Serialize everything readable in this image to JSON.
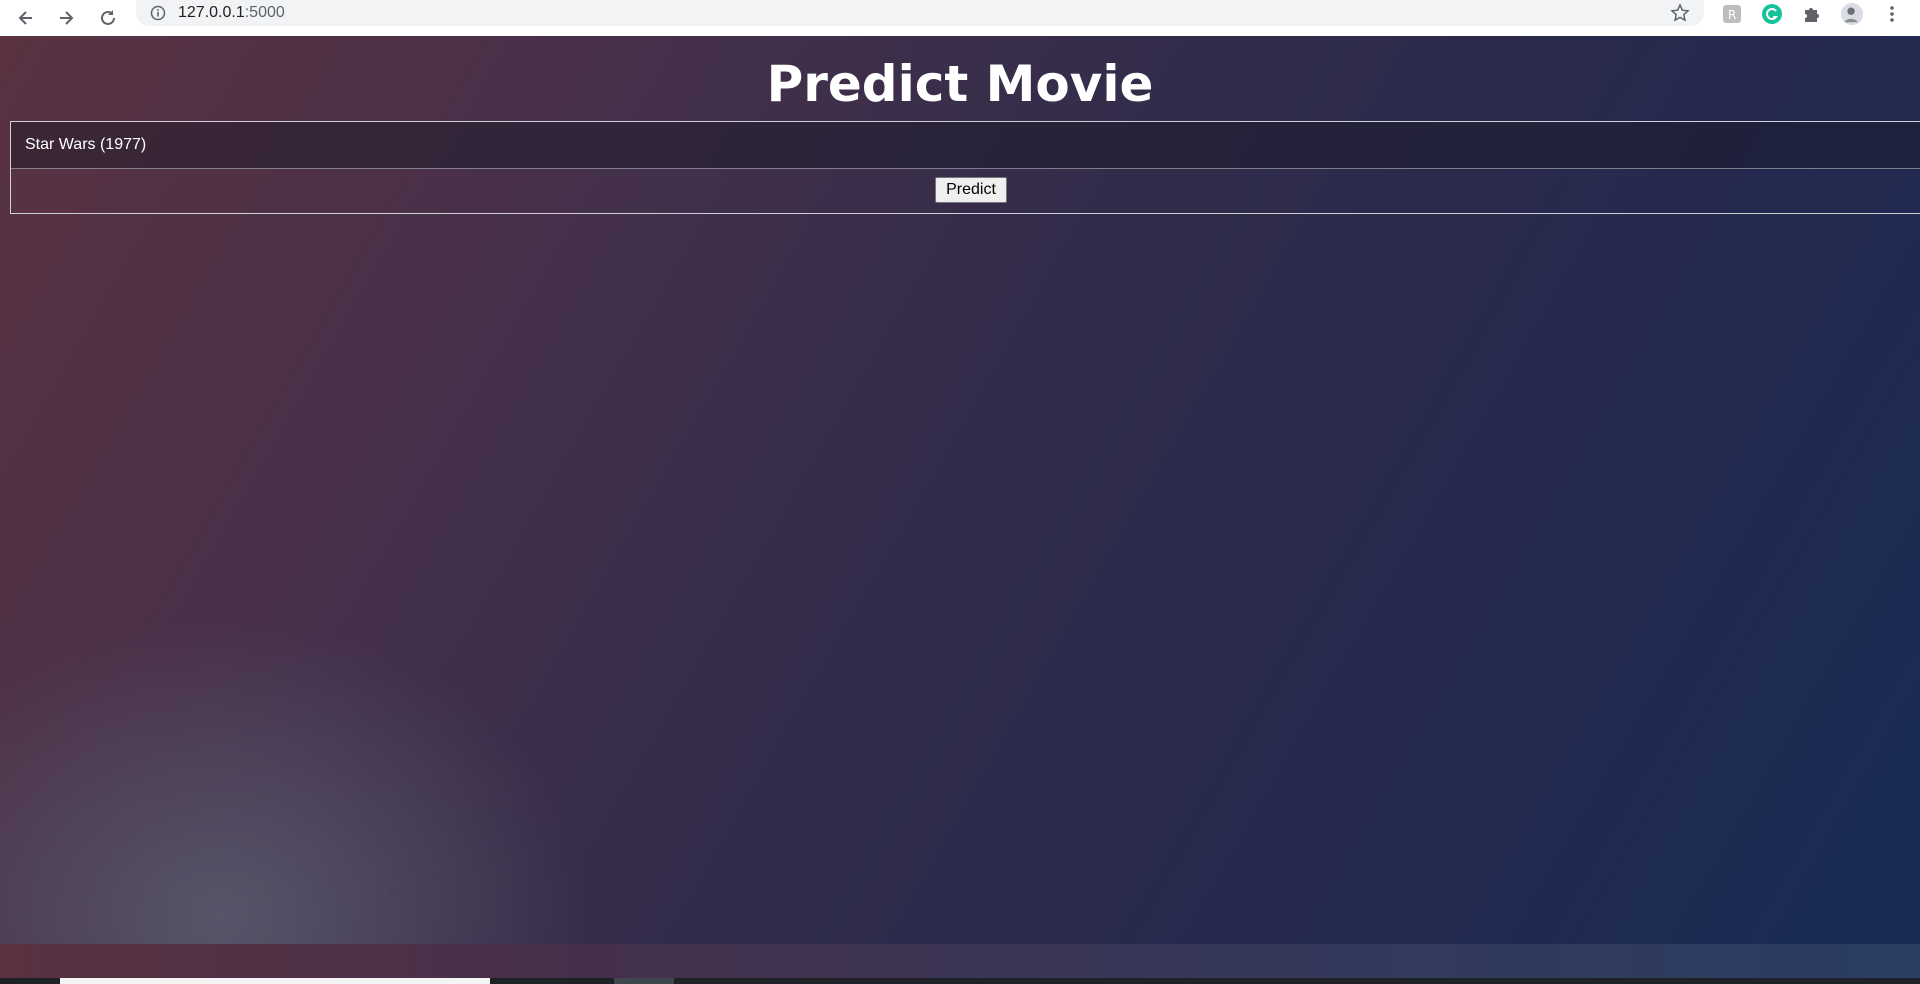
{
  "browser": {
    "url_host": "127.0.0.1",
    "url_port": ":5000",
    "icons": [
      "back-arrow-icon",
      "forward-arrow-icon",
      "reload-icon",
      "info-icon",
      "bookmark-star-icon",
      "extension-r-icon",
      "grammarly-icon",
      "puzzle-extensions-icon",
      "profile-avatar-icon",
      "kebab-menu-icon"
    ],
    "colors": {
      "grammarly": "#15c39a",
      "chrome_bg": "#ffffff",
      "omnibox_bg": "#f1f3f4"
    }
  },
  "page": {
    "title": "Predict Movie",
    "movie_input_value": "Star Wars (1977)",
    "predict_label": "Predict",
    "colors": {
      "gradient_start": "#5a3242",
      "gradient_end": "#182c55",
      "text": "#ffffff"
    }
  }
}
